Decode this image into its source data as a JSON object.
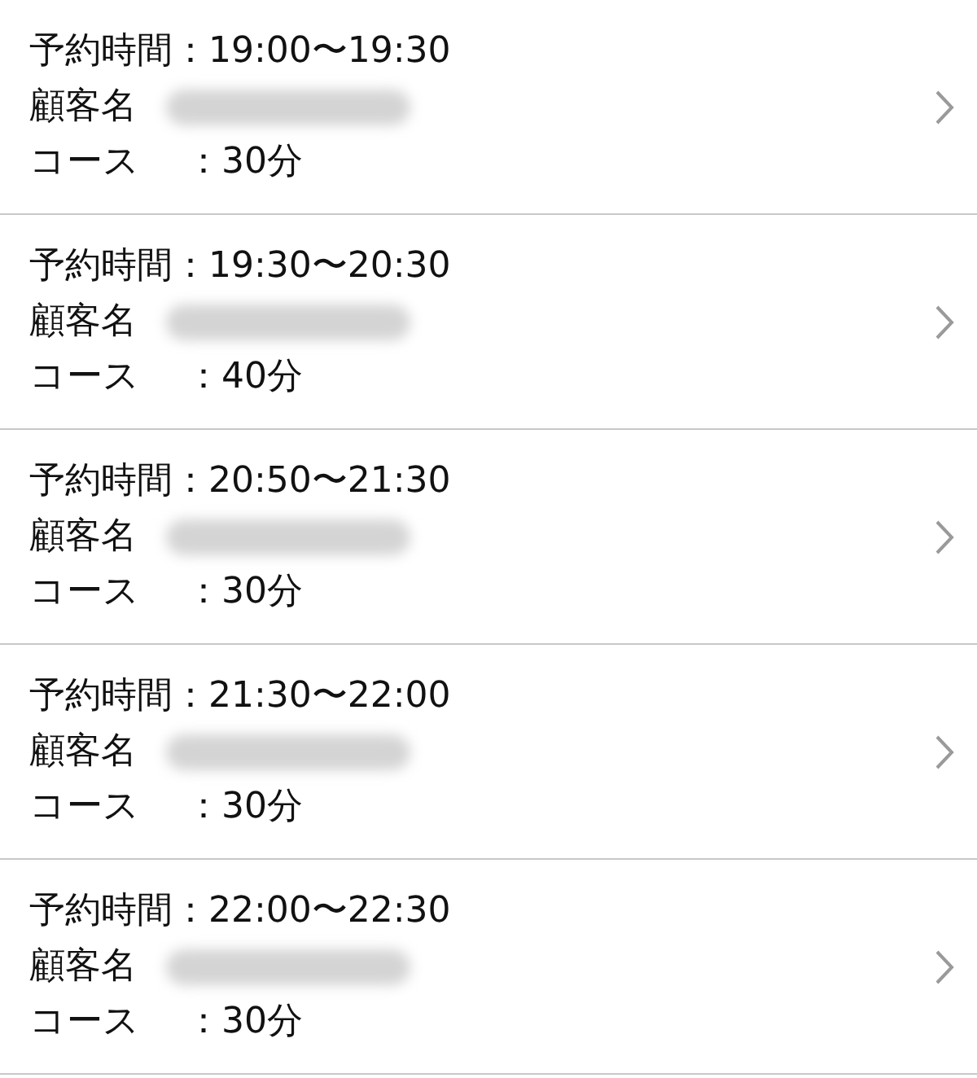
{
  "reservations": [
    {
      "time": "予約時間：19:00〜19:30",
      "customer_label": "顧客名",
      "course_label": "コース",
      "course_value": "：30分"
    },
    {
      "time": "予約時間：19:30〜20:30",
      "customer_label": "顧客名",
      "course_label": "コース",
      "course_value": "：40分"
    },
    {
      "time": "予約時間：20:50〜21:30",
      "customer_label": "顧客名",
      "course_label": "コース",
      "course_value": "：30分"
    },
    {
      "time": "予約時間：21:30〜22:00",
      "customer_label": "顧客名",
      "course_label": "コース",
      "course_value": "：30分"
    },
    {
      "time": "予約時間：22:00〜22:30",
      "customer_label": "顧客名",
      "course_label": "コース",
      "course_value": "：30分"
    }
  ]
}
